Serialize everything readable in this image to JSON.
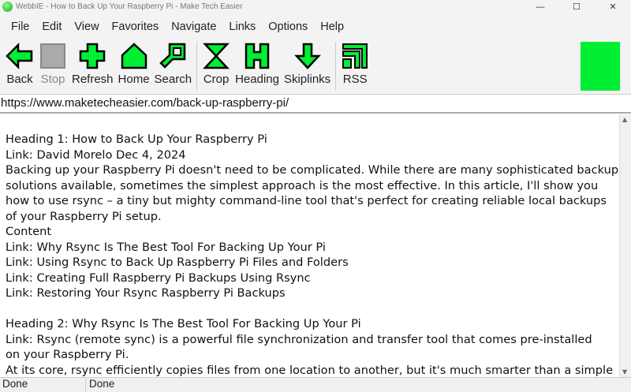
{
  "window": {
    "title": "WebbIE - How to Back Up Your Raspberry Pi - Make Tech Easier",
    "minimize": "—",
    "maximize": "☐",
    "close": "✕"
  },
  "menu": [
    "File",
    "Edit",
    "View",
    "Favorites",
    "Navigate",
    "Links",
    "Options",
    "Help"
  ],
  "toolbar": {
    "back": "Back",
    "stop": "Stop",
    "refresh": "Refresh",
    "home": "Home",
    "search": "Search",
    "crop": "Crop",
    "heading": "Heading",
    "skiplinks": "Skiplinks",
    "rss": "RSS"
  },
  "colors": {
    "accent": "#00ee33"
  },
  "address": "https://www.maketecheasier.com/back-up-raspberry-pi/",
  "content": [
    "Heading 1: How to Back Up Your Raspberry Pi",
    "Link: David Morelo Dec 4, 2024",
    "Backing up your Raspberry Pi doesn't need to be complicated. While there are many sophisticated backup",
    "solutions available, sometimes the simplest approach is the most effective. In this article, I'll show you",
    "how to use rsync – a tiny but mighty command-line tool that's perfect for creating reliable local backups",
    "of your Raspberry Pi setup.",
    "Content",
    "Link: Why Rsync Is The Best Tool For Backing Up Your Pi",
    "Link: Using Rsync to Back Up Raspberry Pi Files and Folders",
    "Link: Creating Full Raspberry Pi Backups Using Rsync",
    "Link: Restoring Your Rsync Raspberry Pi Backups",
    "",
    "Heading 2: Why Rsync Is The Best Tool For Backing Up Your Pi",
    "Link: Rsync (remote sync) is a powerful file synchronization and transfer tool that comes pre-installed",
    "on your Raspberry Pi.",
    "At its core, rsync efficiently copies files from one location to another, but it's much smarter than a simple"
  ],
  "status": {
    "left": "Done",
    "right": "Done"
  }
}
